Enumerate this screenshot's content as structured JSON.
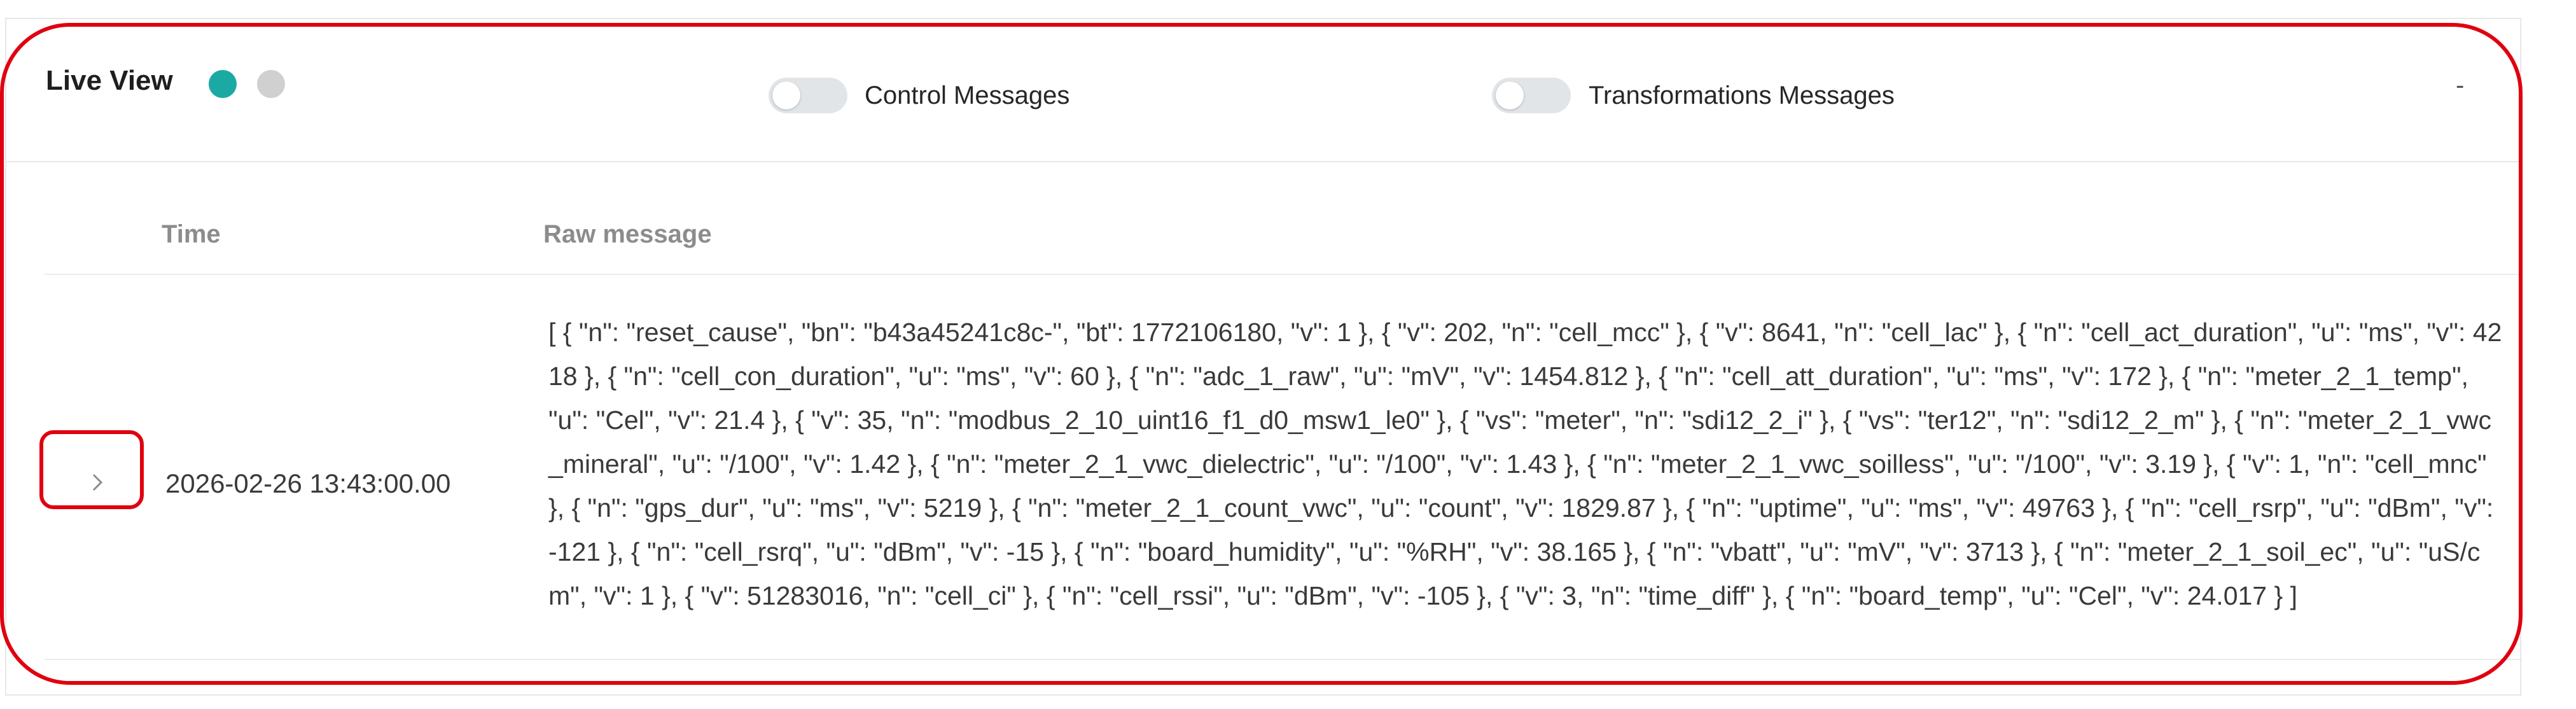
{
  "header": {
    "title": "Live View",
    "status_colors": {
      "live": "#1aaaa3",
      "idle": "#d0d0d0"
    },
    "toggles": [
      {
        "label": "Control Messages",
        "on": false
      },
      {
        "label": "Transformations Messages",
        "on": false
      }
    ],
    "minimize_label": "-"
  },
  "table": {
    "columns": [
      "Time",
      "Raw message"
    ],
    "rows": [
      {
        "expand_icon": "chevron-right-icon",
        "time": "2026-02-26 13:43:00.00",
        "raw_message": "[ { \"n\": \"reset_cause\", \"bn\": \"b43a45241c8c-\", \"bt\": 1772106180, \"v\": 1 }, { \"v\": 202, \"n\": \"cell_mcc\" }, { \"v\": 8641, \"n\": \"cell_lac\" }, { \"n\": \"cell_act_duration\", \"u\": \"ms\", \"v\": 4218 }, { \"n\": \"cell_con_duration\", \"u\": \"ms\", \"v\": 60 }, { \"n\": \"adc_1_raw\", \"u\": \"mV\", \"v\": 1454.812 }, { \"n\": \"cell_att_duration\", \"u\": \"ms\", \"v\": 172 }, { \"n\": \"meter_2_1_temp\", \"u\": \"Cel\", \"v\": 21.4 }, { \"v\": 35, \"n\": \"modbus_2_10_uint16_f1_d0_msw1_le0\" }, { \"vs\": \"meter\", \"n\": \"sdi12_2_i\" }, { \"vs\": \"ter12\", \"n\": \"sdi12_2_m\" }, { \"n\": \"meter_2_1_vwc_mineral\", \"u\": \"/100\", \"v\": 1.42 }, { \"n\": \"meter_2_1_vwc_dielectric\", \"u\": \"/100\", \"v\": 1.43 }, { \"n\": \"meter_2_1_vwc_soilless\", \"u\": \"/100\", \"v\": 3.19 }, { \"v\": 1, \"n\": \"cell_mnc\" }, { \"n\": \"gps_dur\", \"u\": \"ms\", \"v\": 5219 }, { \"n\": \"meter_2_1_count_vwc\", \"u\": \"count\", \"v\": 1829.87 }, { \"n\": \"uptime\", \"u\": \"ms\", \"v\": 49763 }, { \"n\": \"cell_rsrp\", \"u\": \"dBm\", \"v\": -121 }, { \"n\": \"cell_rsrq\", \"u\": \"dBm\", \"v\": -15 }, { \"n\": \"board_humidity\", \"u\": \"%RH\", \"v\": 38.165 }, { \"n\": \"vbatt\", \"u\": \"mV\", \"v\": 3713 }, { \"n\": \"meter_2_1_soil_ec\", \"u\": \"uS/cm\", \"v\": 1 }, { \"v\": 51283016, \"n\": \"cell_ci\" }, { \"n\": \"cell_rssi\", \"u\": \"dBm\", \"v\": -105 }, { \"v\": 3, \"n\": \"time_diff\" }, { \"n\": \"board_temp\", \"u\": \"Cel\", \"v\": 24.017 } ]"
      }
    ]
  },
  "annotation_color": "#e0000f"
}
